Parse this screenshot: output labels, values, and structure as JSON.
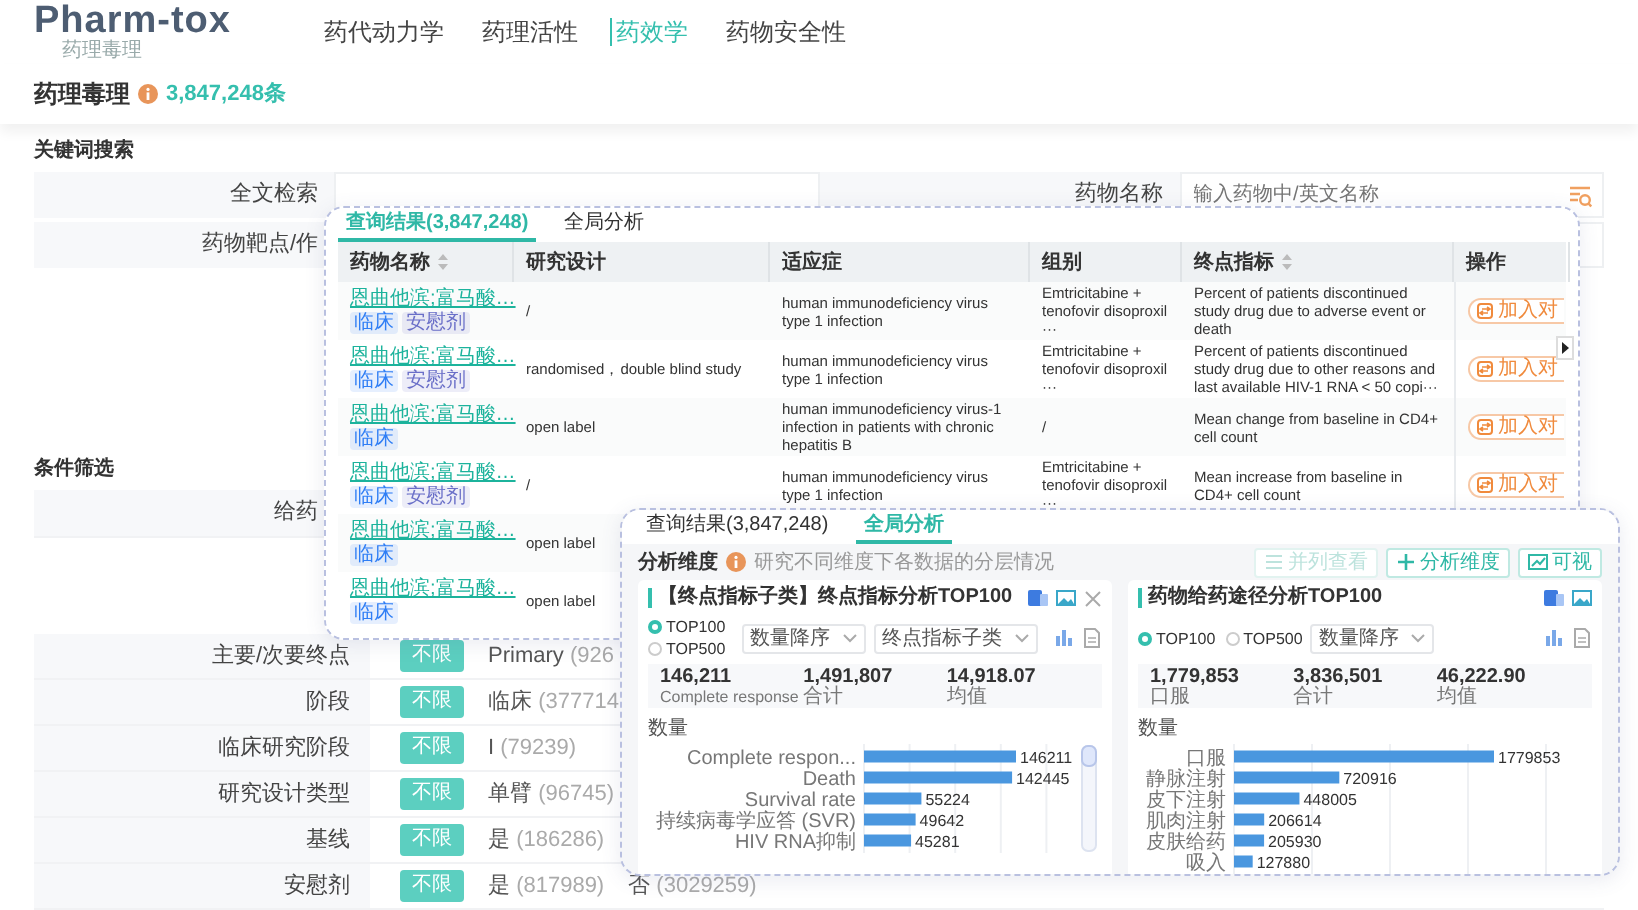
{
  "header": {
    "logo": "Pharm-tox",
    "logo_subtitle": "药理毒理",
    "nav": [
      {
        "label": "药代动力学",
        "selected": false
      },
      {
        "label": "药理活性",
        "selected": false
      },
      {
        "label": "药效学",
        "selected": true
      },
      {
        "label": "药物安全性",
        "selected": false
      }
    ]
  },
  "title": {
    "text": "药理毒理",
    "count": "3,847,248条"
  },
  "keyword_search": {
    "heading": "关键词搜索",
    "rows": [
      {
        "fields": [
          {
            "label": "全文检索",
            "search_icon": false
          },
          {
            "label": "药物名称",
            "placeholder": "输入药物中/英文名称",
            "search_icon": true
          }
        ]
      },
      {
        "fields": [
          {
            "label": "药物靶点/作",
            "search_icon": false
          }
        ]
      }
    ]
  },
  "filters": {
    "heading": "条件筛选",
    "rows": [
      {
        "label": "给药"
      },
      {
        "label": "主要/次要终点",
        "any": "不限",
        "options": [
          {
            "label": "Primary",
            "count": "(926"
          }
        ]
      },
      {
        "label": "阶段",
        "any": "不限",
        "options": [
          {
            "label": "临床",
            "count": "(377714"
          }
        ]
      },
      {
        "label": "临床研究阶段",
        "any": "不限",
        "options": [
          {
            "label": "I",
            "count": "(79239)"
          }
        ]
      },
      {
        "label": "研究设计类型",
        "any": "不限",
        "options": [
          {
            "label": "单臂",
            "count": "(96745)"
          }
        ]
      },
      {
        "label": "基线",
        "any": "不限",
        "options": [
          {
            "label": "是",
            "count": "(186286)"
          }
        ]
      },
      {
        "label": "安慰剂",
        "any": "不限",
        "options": [
          {
            "label": "是",
            "count": "(817989)"
          },
          {
            "label": "否",
            "count": "(3029259)"
          }
        ]
      }
    ]
  },
  "results_panel": {
    "tabs": [
      {
        "label": "查询结果(3,847,248)",
        "selected": true
      },
      {
        "label": "全局分析",
        "selected": false
      }
    ],
    "columns": [
      {
        "label": "药物名称",
        "sortable": true
      },
      {
        "label": "研究设计",
        "sortable": false
      },
      {
        "label": "适应症",
        "sortable": false
      },
      {
        "label": "组别",
        "sortable": false
      },
      {
        "label": "终点指标",
        "sortable": true
      },
      {
        "label": "操作",
        "sortable": false
      }
    ],
    "rows": [
      {
        "drug": "恩曲他滨;富马酸…",
        "tags": [
          {
            "label": "临床",
            "color": "#2f7ef5"
          },
          {
            "label": "安慰剂",
            "color": "#6a6fc8"
          }
        ],
        "design": "/",
        "indication": "human immunodeficiency virus type 1 infection",
        "group": "Emtricitabine + tenofovir disoproxil ···",
        "endpoint": "Percent of patients discontinued study drug due to adverse event or death",
        "action": "加入对"
      },
      {
        "drug": "恩曲他滨;富马酸…",
        "tags": [
          {
            "label": "临床",
            "color": "#2f7ef5"
          },
          {
            "label": "安慰剂",
            "color": "#6a6fc8"
          }
        ],
        "design": "randomised，double blind study",
        "indication": "human immunodeficiency virus type 1 infection",
        "group": "Emtricitabine + tenofovir disoproxil ···",
        "endpoint": "Percent of patients discontinued study drug due to other reasons and last available HIV-1 RNA < 50 copi···",
        "action": "加入对"
      },
      {
        "drug": "恩曲他滨;富马酸…",
        "tags": [
          {
            "label": "临床",
            "color": "#2f7ef5"
          }
        ],
        "design": "open label",
        "indication": "human immunodeficiency virus-1 infection in patients with chronic hepatitis B",
        "group": "/",
        "endpoint": "Mean change from baseline in CD4+ cell count",
        "action": "加入对"
      },
      {
        "drug": "恩曲他滨;富马酸…",
        "tags": [
          {
            "label": "临床",
            "color": "#2f7ef5"
          },
          {
            "label": "安慰剂",
            "color": "#6a6fc8"
          }
        ],
        "design": "/",
        "indication": "human immunodeficiency virus type 1 infection",
        "group": "Emtricitabine + tenofovir disoproxil ···",
        "endpoint": "Mean increase from baseline in CD4+ cell count",
        "action": "加入对"
      },
      {
        "drug": "恩曲他滨;富马酸…",
        "tags": [
          {
            "label": "临床",
            "color": "#2f7ef5"
          }
        ],
        "design": "open label"
      },
      {
        "drug": "恩曲他滨;富马酸…",
        "tags": [
          {
            "label": "临床",
            "color": "#2f7ef5"
          }
        ],
        "design": "open label"
      }
    ]
  },
  "analysis_panel": {
    "tabs": [
      {
        "label": "查询结果(3,847,248)",
        "selected": false
      },
      {
        "label": "全局分析",
        "selected": true
      }
    ],
    "dimension_label": "分析维度",
    "hint": "研究不同维度下各数据的分层情况",
    "buttons": [
      {
        "label": "并列查看",
        "kind": "list",
        "disabled": true
      },
      {
        "label": "分析维度",
        "kind": "add",
        "disabled": false
      },
      {
        "label": "可视",
        "kind": "chart",
        "disabled": false
      }
    ],
    "cards": [
      {
        "title": "【终点指标子类】终点指标分析TOP100",
        "closable": true,
        "radios": [
          {
            "label": "TOP100",
            "selected": true
          },
          {
            "label": "TOP500",
            "selected": false
          }
        ],
        "selects": [
          {
            "value": "数量降序"
          },
          {
            "value": "终点指标子类"
          }
        ],
        "stats": [
          {
            "value": "146,211",
            "label": "Complete response"
          },
          {
            "value": "1,491,807",
            "label": "合计"
          },
          {
            "value": "14,918.07",
            "label": "均值"
          }
        ],
        "chart_data": {
          "type": "bar",
          "orientation": "horizontal",
          "ylabel": "数量",
          "categories": [
            "Complete respon...",
            "Death",
            "Survival rate",
            "持续病毒学应答 (SVR)",
            "HIV RNA抑制"
          ],
          "values": [
            146211,
            142445,
            55224,
            49642,
            45281
          ],
          "data_labels": true
        }
      },
      {
        "title": "药物给药途径分析TOP100",
        "closable": false,
        "radios": [
          {
            "label": "TOP100",
            "selected": true
          },
          {
            "label": "TOP500",
            "selected": false
          }
        ],
        "selects": [
          {
            "value": "数量降序"
          }
        ],
        "stats": [
          {
            "value": "1,779,853",
            "label": "口服"
          },
          {
            "value": "3,836,501",
            "label": "合计"
          },
          {
            "value": "46,222.90",
            "label": "均值"
          }
        ],
        "chart_data": {
          "type": "bar",
          "orientation": "horizontal",
          "ylabel": "数量",
          "categories": [
            "口服",
            "静脉注射",
            "皮下注射",
            "肌肉注射",
            "皮肤给药",
            "吸入"
          ],
          "values": [
            1779853,
            720916,
            448005,
            206614,
            205930,
            127880
          ],
          "data_labels": true
        }
      }
    ]
  }
}
